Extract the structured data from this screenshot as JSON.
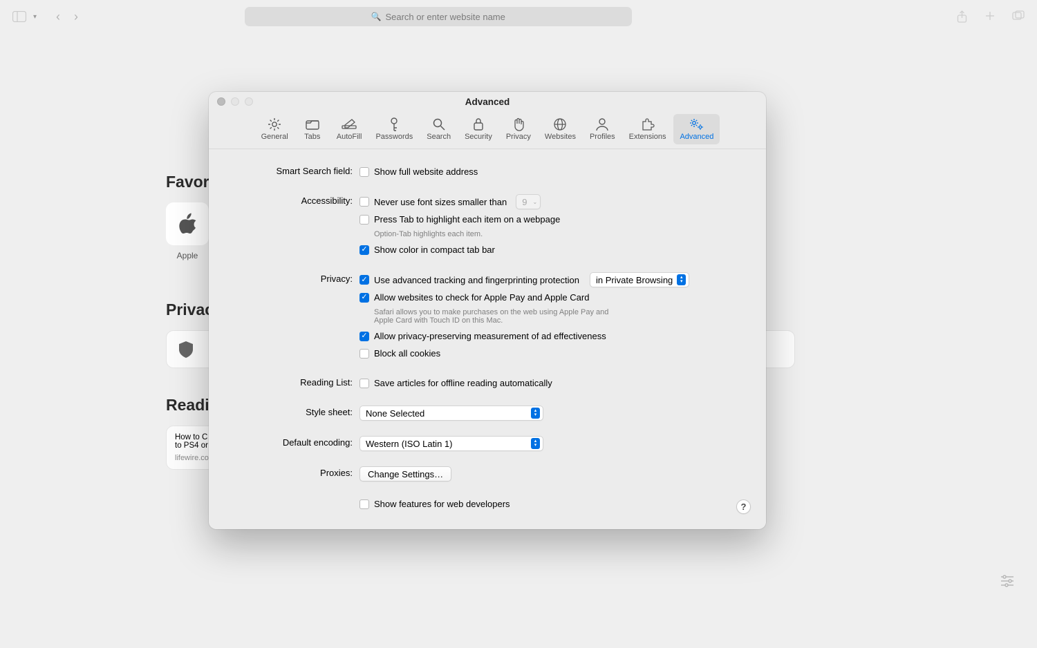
{
  "toolbar": {
    "search_placeholder": "Search or enter website name"
  },
  "background": {
    "favorites_heading": "Favori",
    "favorite_label": "Apple",
    "privacy_heading": "Privac",
    "reading_heading": "Readin",
    "reading_item_title": "How to C",
    "reading_item_line2": "to PS4 or",
    "reading_item_source": "lifewire.co"
  },
  "prefs": {
    "title": "Advanced",
    "tabs": [
      {
        "label": "General"
      },
      {
        "label": "Tabs"
      },
      {
        "label": "AutoFill"
      },
      {
        "label": "Passwords"
      },
      {
        "label": "Search"
      },
      {
        "label": "Security"
      },
      {
        "label": "Privacy"
      },
      {
        "label": "Websites"
      },
      {
        "label": "Profiles"
      },
      {
        "label": "Extensions"
      },
      {
        "label": "Advanced"
      }
    ],
    "sections": {
      "smart_search": {
        "label": "Smart Search field:",
        "show_full_address": "Show full website address"
      },
      "accessibility": {
        "label": "Accessibility:",
        "never_font_smaller": "Never use font sizes smaller than",
        "font_size_value": "9",
        "press_tab": "Press Tab to highlight each item on a webpage",
        "option_tab_hint": "Option-Tab highlights each item.",
        "show_color": "Show color in compact tab bar"
      },
      "privacy": {
        "label": "Privacy:",
        "advanced_tracking": "Use advanced tracking and fingerprinting protection",
        "tracking_mode": "in Private Browsing",
        "apple_pay": "Allow websites to check for Apple Pay and Apple Card",
        "apple_pay_hint": "Safari allows you to make purchases on the web using Apple Pay and Apple Card with Touch ID on this Mac.",
        "ad_measurement": "Allow privacy-preserving measurement of ad effectiveness",
        "block_cookies": "Block all cookies"
      },
      "reading_list": {
        "label": "Reading List:",
        "save_offline": "Save articles for offline reading automatically"
      },
      "style_sheet": {
        "label": "Style sheet:",
        "value": "None Selected"
      },
      "default_encoding": {
        "label": "Default encoding:",
        "value": "Western (ISO Latin 1)"
      },
      "proxies": {
        "label": "Proxies:",
        "button": "Change Settings…"
      },
      "developer": {
        "show_features": "Show features for web developers"
      },
      "help": "?"
    }
  }
}
